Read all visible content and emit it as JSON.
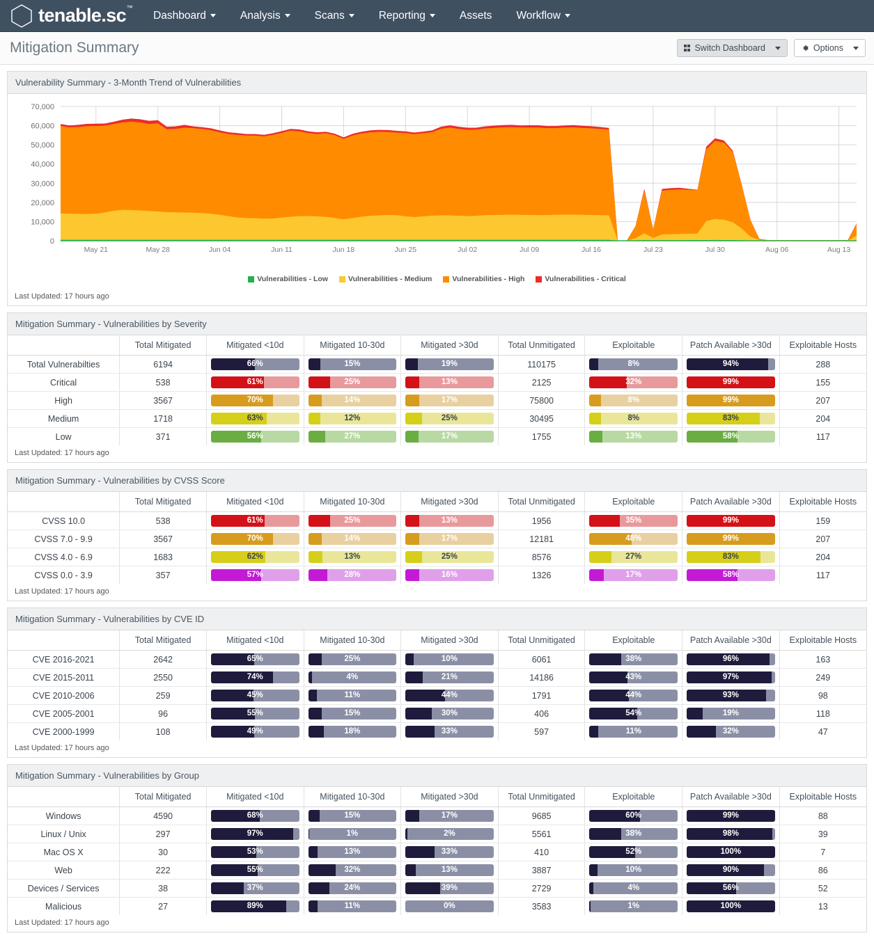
{
  "nav": {
    "brand": "tenable.sc",
    "brand_tm": "™",
    "items": [
      {
        "label": "Dashboard",
        "caret": true
      },
      {
        "label": "Analysis",
        "caret": true
      },
      {
        "label": "Scans",
        "caret": true
      },
      {
        "label": "Reporting",
        "caret": true
      },
      {
        "label": "Assets",
        "caret": false
      },
      {
        "label": "Workflow",
        "caret": true
      }
    ]
  },
  "titlebar": {
    "title": "Mitigation Summary",
    "switch_dashboard": "Switch Dashboard",
    "options": "Options"
  },
  "last_updated": "Last Updated: 17 hours ago",
  "colors": {
    "navy": "#1e1b3c",
    "navy_track": "#8b8fa6",
    "red": "#d31117",
    "red_track": "#e8999c",
    "orange": "#d79c1e",
    "orange_track": "#e8d0a0",
    "yellow": "#d6cf1a",
    "yellow_track": "#e9e69a",
    "green": "#6aad42",
    "green_track": "#b8d9a3",
    "purple": "#c41ad6",
    "purple_track": "#dfa0e9",
    "brand_bar": "#3f5061",
    "sev_low": "#22b14c",
    "sev_medium": "#fdc82f",
    "sev_high": "#ff8c00",
    "sev_critical": "#ee2b2b"
  },
  "chart_panel": {
    "title": "Vulnerability Summary - 3-Month Trend of Vulnerabilities"
  },
  "chart_data": {
    "type": "area",
    "title": "Vulnerability Summary - 3-Month Trend of Vulnerabilities",
    "stacked": true,
    "xlabel": "",
    "ylabel": "",
    "ylim": [
      0,
      70000
    ],
    "yticks": [
      "0",
      "10,000",
      "20,000",
      "30,000",
      "40,000",
      "50,000",
      "60,000",
      "70,000"
    ],
    "xticks": [
      "May 21",
      "May 28",
      "Jun 04",
      "Jun 11",
      "Jun 18",
      "Jun 25",
      "Jul 02",
      "Jul 09",
      "Jul 16",
      "Jul 23",
      "Jul 30",
      "Aug 06",
      "Aug 13"
    ],
    "grid": true,
    "legend_position": "bottom",
    "legend": [
      {
        "name": "Vulnerabilities - Low",
        "color": "#22b14c"
      },
      {
        "name": "Vulnerabilities - Medium",
        "color": "#fdc82f"
      },
      {
        "name": "Vulnerabilities - High",
        "color": "#ff8c00"
      },
      {
        "name": "Vulnerabilities - Critical",
        "color": "#ee2b2b"
      }
    ],
    "series": [
      {
        "name": "Vulnerabilities - Low",
        "color": "#22b14c",
        "values": [
          520,
          520,
          520,
          520,
          520,
          520,
          520,
          520,
          520,
          520,
          520,
          520,
          520,
          520,
          520,
          520,
          520,
          520,
          520,
          520,
          520,
          520,
          520,
          520,
          520,
          520,
          520,
          520,
          520,
          520,
          520,
          520,
          520,
          520,
          520,
          520,
          520,
          520,
          520,
          520,
          520,
          520,
          520,
          520,
          520,
          520,
          520,
          520,
          520,
          520,
          520,
          520,
          520,
          520,
          520,
          520,
          520,
          520,
          520,
          520,
          520,
          520,
          520,
          0,
          0,
          220,
          300,
          260,
          300,
          310,
          330,
          350,
          360,
          380,
          400,
          380,
          350,
          260,
          150,
          0,
          0,
          0,
          0,
          0,
          0,
          0,
          0,
          0,
          0,
          0,
          60
        ]
      },
      {
        "name": "Vulnerabilities - Medium",
        "color": "#fdc82f",
        "values": [
          13700,
          13600,
          13500,
          13400,
          13600,
          14200,
          15100,
          15600,
          15500,
          15300,
          15000,
          14700,
          14400,
          14300,
          14200,
          14100,
          13900,
          13600,
          13000,
          12300,
          11600,
          11300,
          11200,
          11000,
          11100,
          11600,
          12000,
          12300,
          12400,
          12200,
          11900,
          11300,
          10700,
          11300,
          12000,
          12500,
          12700,
          12900,
          12800,
          12200,
          11800,
          12200,
          12600,
          12700,
          12700,
          12500,
          12300,
          12500,
          12800,
          12900,
          13000,
          13100,
          13000,
          12900,
          12800,
          12900,
          13000,
          13100,
          13100,
          13000,
          12900,
          12800,
          12700,
          0,
          0,
          1100,
          3600,
          1200,
          3000,
          3100,
          3200,
          3300,
          3400,
          9800,
          11000,
          10600,
          9300,
          6200,
          2000,
          400,
          0,
          0,
          0,
          0,
          0,
          0,
          0,
          0,
          0,
          0,
          2600
        ]
      },
      {
        "name": "Vulnerabilities - High",
        "color": "#ff8c00",
        "values": [
          45600,
          45000,
          45300,
          45800,
          45700,
          45300,
          45200,
          45600,
          46100,
          45900,
          45300,
          46000,
          43200,
          43500,
          44200,
          44100,
          43900,
          43500,
          43000,
          42800,
          43100,
          43000,
          43100,
          42900,
          43600,
          44100,
          44900,
          44200,
          43200,
          42900,
          43600,
          43200,
          41900,
          43000,
          43400,
          43500,
          43600,
          43300,
          43100,
          43400,
          43200,
          43300,
          43500,
          45100,
          45800,
          45300,
          45000,
          44900,
          45200,
          45400,
          45600,
          45600,
          45500,
          45600,
          45700,
          45300,
          45200,
          45400,
          45500,
          45300,
          45200,
          45000,
          44700,
          0,
          0,
          6300,
          22200,
          4400,
          22800,
          23100,
          23200,
          22900,
          22600,
          37500,
          40700,
          40200,
          36700,
          22800,
          8700,
          600,
          300,
          300,
          300,
          300,
          300,
          300,
          300,
          300,
          300,
          300,
          6200
        ]
      },
      {
        "name": "Vulnerabilities - Critical",
        "color": "#ee2b2b",
        "values": [
          1000,
          1000,
          1100,
          1200,
          1200,
          1100,
          1200,
          1400,
          1600,
          1600,
          1700,
          1600,
          1300,
          1300,
          1500,
          900,
          900,
          1000,
          1000,
          900,
          900,
          800,
          800,
          800,
          800,
          900,
          900,
          1000,
          900,
          900,
          800,
          800,
          800,
          900,
          900,
          1000,
          1000,
          1000,
          900,
          900,
          900,
          900,
          900,
          1100,
          1200,
          1100,
          1100,
          1000,
          1100,
          1200,
          1200,
          1200,
          1100,
          1200,
          1200,
          1100,
          1100,
          1100,
          1200,
          1100,
          1100,
          1000,
          900,
          0,
          0,
          0,
          900,
          0,
          900,
          900,
          900,
          500,
          200,
          1300,
          1300,
          1100,
          600,
          200,
          0,
          0,
          0,
          0,
          0,
          0,
          0,
          0,
          0,
          0,
          0,
          0,
          200
        ]
      }
    ]
  },
  "common_headers": [
    "",
    "Total Mitigated",
    "Mitigated <10d",
    "Mitigated 10-30d",
    "Mitigated >30d",
    "Total Unmitigated",
    "Exploitable",
    "Patch Available >30d",
    "Exploitable Hosts"
  ],
  "tables": [
    {
      "title": "Mitigation Summary - Vulnerabilities by Severity",
      "rows": [
        {
          "label": "Total Vulnerabilties",
          "total_mitigated": "6194",
          "m10": "66%",
          "m1030": "15%",
          "m30": "19%",
          "total_unmitigated": "110175",
          "exploitable": "8%",
          "patch": "94%",
          "hosts": "288",
          "theme": "navy",
          "m10_w": 50,
          "m1030_w": 14,
          "m30_w": 14,
          "exploitable_w": 10,
          "patch_w": 92
        },
        {
          "label": "Critical",
          "total_mitigated": "538",
          "m10": "61%",
          "m1030": "25%",
          "m30": "13%",
          "total_unmitigated": "2125",
          "exploitable": "32%",
          "patch": "99%",
          "hosts": "155",
          "theme": "red",
          "m10_w": 60,
          "m1030_w": 25,
          "m30_w": 16,
          "exploitable_w": 42,
          "patch_w": 100
        },
        {
          "label": "High",
          "total_mitigated": "3567",
          "m10": "70%",
          "m1030": "14%",
          "m30": "17%",
          "total_unmitigated": "75800",
          "exploitable": "8%",
          "patch": "99%",
          "hosts": "207",
          "theme": "orange",
          "m10_w": 70,
          "m1030_w": 15,
          "m30_w": 16,
          "exploitable_w": 13,
          "patch_w": 100
        },
        {
          "label": "Medium",
          "total_mitigated": "1718",
          "m10": "63%",
          "m1030": "12%",
          "m30": "25%",
          "total_unmitigated": "30495",
          "exploitable": "8%",
          "patch": "83%",
          "hosts": "204",
          "theme": "yellow",
          "m10_w": 63,
          "m1030_w": 14,
          "m30_w": 19,
          "exploitable_w": 13,
          "patch_w": 83
        },
        {
          "label": "Low",
          "total_mitigated": "371",
          "m10": "56%",
          "m1030": "27%",
          "m30": "17%",
          "total_unmitigated": "1755",
          "exploitable": "13%",
          "patch": "58%",
          "hosts": "117",
          "theme": "green",
          "m10_w": 57,
          "m1030_w": 19,
          "m30_w": 15,
          "exploitable_w": 15,
          "patch_w": 58
        }
      ]
    },
    {
      "title": "Mitigation Summary - Vulnerabilities by CVSS Score",
      "rows": [
        {
          "label": "CVSS 10.0",
          "total_mitigated": "538",
          "m10": "61%",
          "m1030": "25%",
          "m30": "13%",
          "total_unmitigated": "1956",
          "exploitable": "35%",
          "patch": "99%",
          "hosts": "159",
          "theme": "red",
          "m10_w": 61,
          "m1030_w": 25,
          "m30_w": 16,
          "exploitable_w": 34,
          "patch_w": 100
        },
        {
          "label": "CVSS 7.0 - 9.9",
          "total_mitigated": "3567",
          "m10": "70%",
          "m1030": "14%",
          "m30": "17%",
          "total_unmitigated": "12181",
          "exploitable": "48%",
          "patch": "99%",
          "hosts": "207",
          "theme": "orange",
          "m10_w": 70,
          "m1030_w": 15,
          "m30_w": 16,
          "exploitable_w": 48,
          "patch_w": 100
        },
        {
          "label": "CVSS 4.0 - 6.9",
          "total_mitigated": "1683",
          "m10": "62%",
          "m1030": "13%",
          "m30": "25%",
          "total_unmitigated": "8576",
          "exploitable": "27%",
          "patch": "83%",
          "hosts": "204",
          "theme": "yellow",
          "m10_w": 62,
          "m1030_w": 16,
          "m30_w": 19,
          "exploitable_w": 25,
          "patch_w": 84
        },
        {
          "label": "CVSS 0.0 - 3.9",
          "total_mitigated": "357",
          "m10": "57%",
          "m1030": "28%",
          "m30": "16%",
          "total_unmitigated": "1326",
          "exploitable": "17%",
          "patch": "58%",
          "hosts": "117",
          "theme": "purple",
          "m10_w": 57,
          "m1030_w": 22,
          "m30_w": 16,
          "exploitable_w": 16,
          "patch_w": 58
        }
      ]
    },
    {
      "title": "Mitigation Summary - Vulnerabilities by CVE ID",
      "rows": [
        {
          "label": "CVE 2016-2021",
          "total_mitigated": "2642",
          "m10": "65%",
          "m1030": "25%",
          "m30": "10%",
          "total_unmitigated": "6061",
          "exploitable": "38%",
          "patch": "96%",
          "hosts": "163",
          "theme": "navy",
          "m10_w": 49,
          "m1030_w": 15,
          "m30_w": 9,
          "exploitable_w": 36,
          "patch_w": 94
        },
        {
          "label": "CVE 2015-2011",
          "total_mitigated": "2550",
          "m10": "74%",
          "m1030": "4%",
          "m30": "21%",
          "total_unmitigated": "14186",
          "exploitable": "43%",
          "patch": "97%",
          "hosts": "249",
          "theme": "navy",
          "m10_w": 70,
          "m1030_w": 4,
          "m30_w": 20,
          "exploitable_w": 43,
          "patch_w": 96
        },
        {
          "label": "CVE 2010-2006",
          "total_mitigated": "259",
          "m10": "45%",
          "m1030": "11%",
          "m30": "44%",
          "total_unmitigated": "1791",
          "exploitable": "44%",
          "patch": "93%",
          "hosts": "98",
          "theme": "navy",
          "m10_w": 48,
          "m1030_w": 10,
          "m30_w": 45,
          "exploitable_w": 45,
          "patch_w": 90
        },
        {
          "label": "CVE 2005-2001",
          "total_mitigated": "96",
          "m10": "55%",
          "m1030": "15%",
          "m30": "30%",
          "total_unmitigated": "406",
          "exploitable": "54%",
          "patch": "19%",
          "hosts": "118",
          "theme": "navy",
          "m10_w": 50,
          "m1030_w": 15,
          "m30_w": 30,
          "exploitable_w": 54,
          "patch_w": 18
        },
        {
          "label": "CVE 2000-1999",
          "total_mitigated": "108",
          "m10": "49%",
          "m1030": "18%",
          "m30": "33%",
          "total_unmitigated": "597",
          "exploitable": "11%",
          "patch": "32%",
          "hosts": "47",
          "theme": "navy",
          "m10_w": 49,
          "m1030_w": 18,
          "m30_w": 33,
          "exploitable_w": 10,
          "patch_w": 33
        }
      ]
    },
    {
      "title": "Mitigation Summary - Vulnerabilities by Group",
      "rows": [
        {
          "label": "Windows",
          "total_mitigated": "4590",
          "m10": "68%",
          "m1030": "15%",
          "m30": "17%",
          "total_unmitigated": "9685",
          "exploitable": "60%",
          "patch": "99%",
          "hosts": "88",
          "theme": "navy",
          "m10_w": 55,
          "m1030_w": 13,
          "m30_w": 16,
          "exploitable_w": 57,
          "patch_w": 100
        },
        {
          "label": "Linux / Unix",
          "total_mitigated": "297",
          "m10": "97%",
          "m1030": "1%",
          "m30": "2%",
          "total_unmitigated": "5561",
          "exploitable": "38%",
          "patch": "98%",
          "hosts": "39",
          "theme": "navy",
          "m10_w": 93,
          "m1030_w": 1,
          "m30_w": 2,
          "exploitable_w": 36,
          "patch_w": 97
        },
        {
          "label": "Mac OS X",
          "total_mitigated": "30",
          "m10": "53%",
          "m1030": "13%",
          "m30": "33%",
          "total_unmitigated": "410",
          "exploitable": "52%",
          "patch": "100%",
          "hosts": "7",
          "theme": "navy",
          "m10_w": 51,
          "m1030_w": 11,
          "m30_w": 33,
          "exploitable_w": 52,
          "patch_w": 100
        },
        {
          "label": "Web",
          "total_mitigated": "222",
          "m10": "55%",
          "m1030": "32%",
          "m30": "13%",
          "total_unmitigated": "3887",
          "exploitable": "10%",
          "patch": "90%",
          "hosts": "86",
          "theme": "navy",
          "m10_w": 53,
          "m1030_w": 31,
          "m30_w": 12,
          "exploitable_w": 9,
          "patch_w": 88
        },
        {
          "label": "Devices / Services",
          "total_mitigated": "38",
          "m10": "37%",
          "m1030": "24%",
          "m30": "39%",
          "total_unmitigated": "2729",
          "exploitable": "4%",
          "patch": "56%",
          "hosts": "52",
          "theme": "navy",
          "m10_w": 37,
          "m1030_w": 24,
          "m30_w": 39,
          "exploitable_w": 4,
          "patch_w": 56
        },
        {
          "label": "Malicious",
          "total_mitigated": "27",
          "m10": "89%",
          "m1030": "11%",
          "m30": "0%",
          "total_unmitigated": "3583",
          "exploitable": "1%",
          "patch": "100%",
          "hosts": "13",
          "theme": "navy",
          "m10_w": 85,
          "m1030_w": 11,
          "m30_w": 0,
          "exploitable_w": 1,
          "patch_w": 100
        }
      ]
    }
  ]
}
